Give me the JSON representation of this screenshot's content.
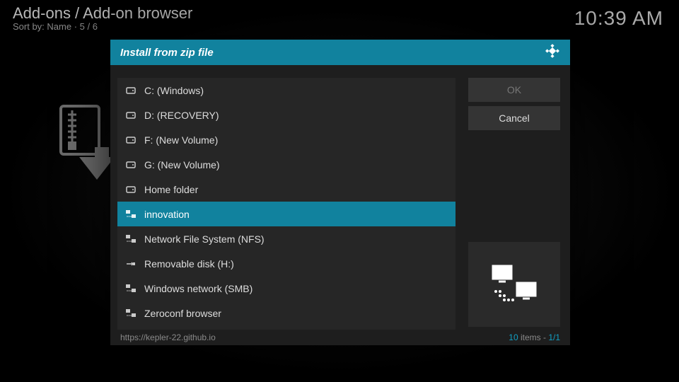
{
  "header": {
    "breadcrumb": "Add-ons / Add-on browser",
    "sort_label": "Sort by: Name  ·  5 / 6"
  },
  "clock": "10:39 AM",
  "dialog": {
    "title": "Install from zip file",
    "buttons": {
      "ok": "OK",
      "cancel": "Cancel"
    },
    "footer_path": "https://kepler-22.github.io",
    "footer_count_num": "10",
    "footer_items_word": " items - ",
    "footer_page": "1/1"
  },
  "items": [
    {
      "label": "C: (Windows)",
      "icon": "drive",
      "selected": false
    },
    {
      "label": "D: (RECOVERY)",
      "icon": "drive",
      "selected": false
    },
    {
      "label": "F: (New Volume)",
      "icon": "drive",
      "selected": false
    },
    {
      "label": "G: (New Volume)",
      "icon": "drive",
      "selected": false
    },
    {
      "label": "Home folder",
      "icon": "drive",
      "selected": false
    },
    {
      "label": "innovation",
      "icon": "network",
      "selected": true
    },
    {
      "label": "Network File System (NFS)",
      "icon": "network",
      "selected": false
    },
    {
      "label": "Removable disk (H:)",
      "icon": "usb",
      "selected": false
    },
    {
      "label": "Windows network (SMB)",
      "icon": "network",
      "selected": false
    },
    {
      "label": "Zeroconf browser",
      "icon": "network",
      "selected": false
    }
  ]
}
